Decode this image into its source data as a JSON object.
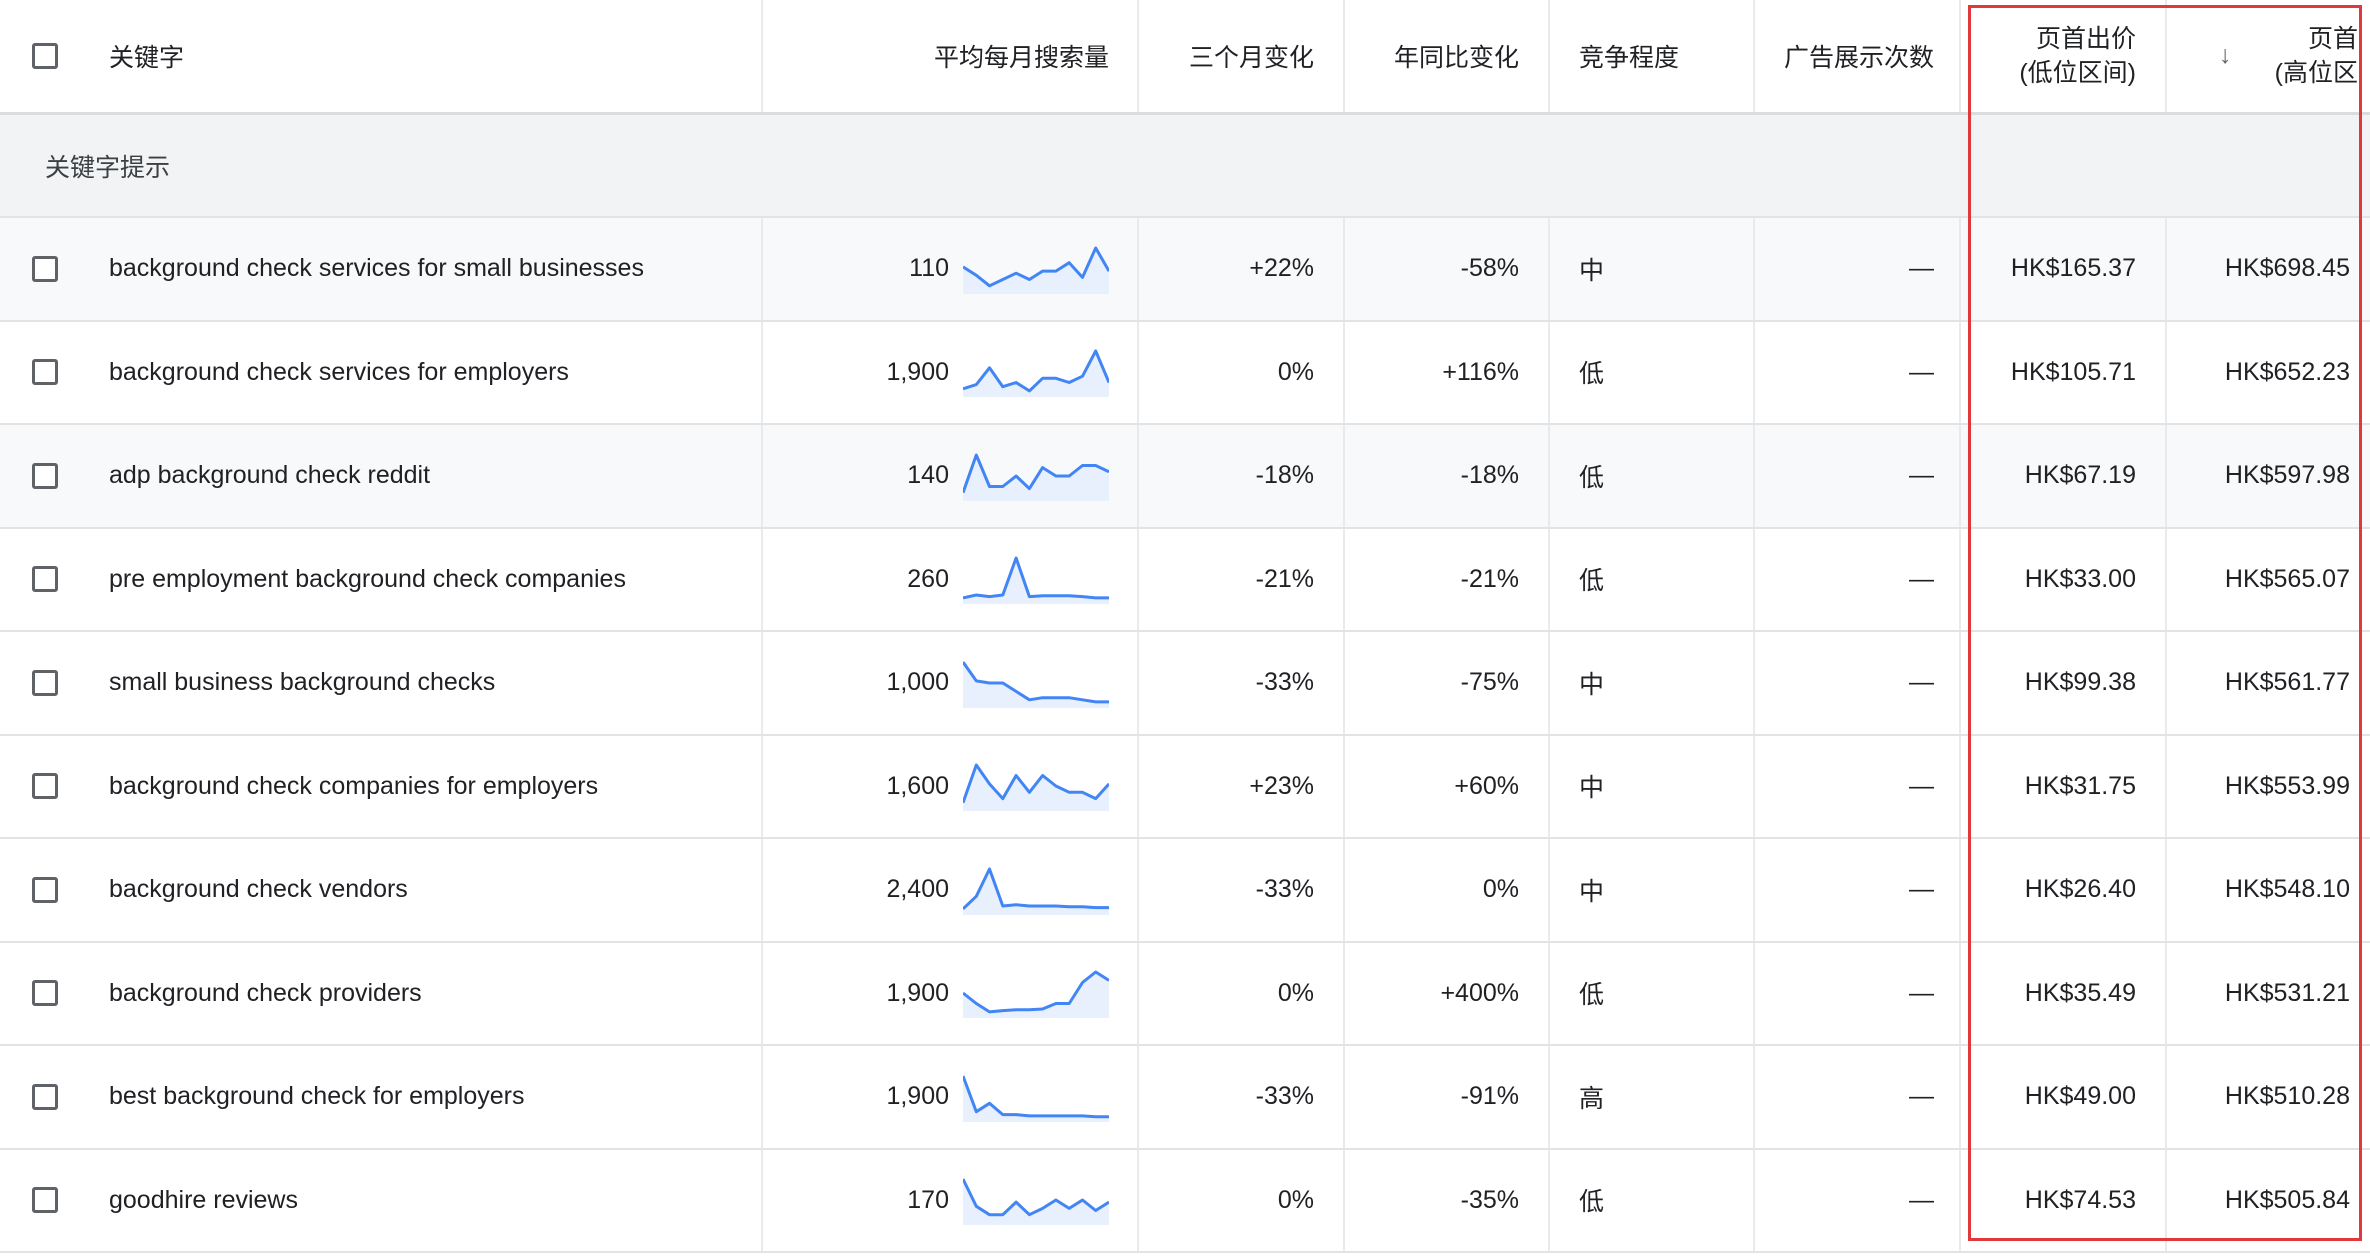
{
  "header": {
    "keyword": "关键字",
    "avg_monthly": "平均每月搜索量",
    "three_month": "三个月变化",
    "yoy": "年同比变化",
    "competition": "竞争程度",
    "ad_impr": "广告展示次数",
    "low_bid_line1": "页首出价",
    "low_bid_line2": "(低位区间)",
    "high_bid_line1": "页首",
    "high_bid_line2": "(高位区",
    "sort_icon": "arrow-down-icon"
  },
  "group_label": "关键字提示",
  "accent_color": "#4285f4",
  "highlight_color": "#e0383b",
  "rows": [
    {
      "keyword": "background check services for small businesses",
      "volume": "110",
      "three_month": "+22%",
      "yoy": "-58%",
      "competition": "中",
      "ad_impr": "—",
      "low_bid": "HK$165.37",
      "high_bid": "HK$698.45",
      "trend": [
        0.55,
        0.35,
        0.1,
        0.25,
        0.4,
        0.25,
        0.45,
        0.45,
        0.65,
        0.3,
        1.0,
        0.45
      ]
    },
    {
      "keyword": "background check services for employers",
      "volume": "1,900",
      "three_month": "0%",
      "yoy": "+116%",
      "competition": "低",
      "ad_impr": "—",
      "low_bid": "HK$105.71",
      "high_bid": "HK$652.23",
      "trend": [
        0.1,
        0.2,
        0.6,
        0.15,
        0.25,
        0.05,
        0.35,
        0.35,
        0.25,
        0.4,
        1.0,
        0.25
      ]
    },
    {
      "keyword": "adp background check reddit",
      "volume": "140",
      "three_month": "-18%",
      "yoy": "-18%",
      "competition": "低",
      "ad_impr": "—",
      "low_bid": "HK$67.19",
      "high_bid": "HK$597.98",
      "trend": [
        0.1,
        1.0,
        0.25,
        0.25,
        0.5,
        0.2,
        0.7,
        0.5,
        0.5,
        0.75,
        0.75,
        0.6
      ]
    },
    {
      "keyword": "pre employment background check companies",
      "volume": "260",
      "three_month": "-21%",
      "yoy": "-21%",
      "competition": "低",
      "ad_impr": "—",
      "low_bid": "HK$33.00",
      "high_bid": "HK$565.07",
      "trend": [
        0.05,
        0.12,
        0.08,
        0.12,
        1.0,
        0.08,
        0.1,
        0.1,
        0.1,
        0.08,
        0.05,
        0.05
      ]
    },
    {
      "keyword": "small business background checks",
      "volume": "1,000",
      "three_month": "-33%",
      "yoy": "-75%",
      "competition": "中",
      "ad_impr": "—",
      "low_bid": "HK$99.38",
      "high_bid": "HK$561.77",
      "trend": [
        1.0,
        0.55,
        0.5,
        0.5,
        0.3,
        0.1,
        0.15,
        0.15,
        0.15,
        0.1,
        0.05,
        0.05
      ]
    },
    {
      "keyword": "background check companies for employers",
      "volume": "1,600",
      "three_month": "+23%",
      "yoy": "+60%",
      "competition": "中",
      "ad_impr": "—",
      "low_bid": "HK$31.75",
      "high_bid": "HK$553.99",
      "trend": [
        0.1,
        1.0,
        0.55,
        0.2,
        0.75,
        0.35,
        0.75,
        0.5,
        0.35,
        0.35,
        0.2,
        0.55
      ]
    },
    {
      "keyword": "background check vendors",
      "volume": "2,400",
      "three_month": "-33%",
      "yoy": "0%",
      "competition": "中",
      "ad_impr": "—",
      "low_bid": "HK$26.40",
      "high_bid": "HK$548.10",
      "trend": [
        0.05,
        0.35,
        1.0,
        0.12,
        0.15,
        0.12,
        0.12,
        0.12,
        0.1,
        0.1,
        0.08,
        0.08
      ]
    },
    {
      "keyword": "background check providers",
      "volume": "1,900",
      "three_month": "0%",
      "yoy": "+400%",
      "competition": "低",
      "ad_impr": "—",
      "low_bid": "HK$35.49",
      "high_bid": "HK$531.21",
      "trend": [
        0.5,
        0.25,
        0.05,
        0.08,
        0.1,
        0.1,
        0.12,
        0.25,
        0.25,
        0.75,
        1.0,
        0.8
      ]
    },
    {
      "keyword": "best background check for employers",
      "volume": "1,900",
      "three_month": "-33%",
      "yoy": "-91%",
      "competition": "高",
      "ad_impr": "—",
      "low_bid": "HK$49.00",
      "high_bid": "HK$510.28",
      "trend": [
        1.0,
        0.15,
        0.35,
        0.08,
        0.08,
        0.05,
        0.05,
        0.05,
        0.05,
        0.05,
        0.03,
        0.03
      ]
    },
    {
      "keyword": "goodhire reviews",
      "volume": "170",
      "three_month": "0%",
      "yoy": "-35%",
      "competition": "低",
      "ad_impr": "—",
      "low_bid": "HK$74.53",
      "high_bid": "HK$505.84",
      "trend": [
        1.0,
        0.35,
        0.15,
        0.15,
        0.45,
        0.15,
        0.3,
        0.5,
        0.3,
        0.5,
        0.25,
        0.45
      ]
    }
  ]
}
